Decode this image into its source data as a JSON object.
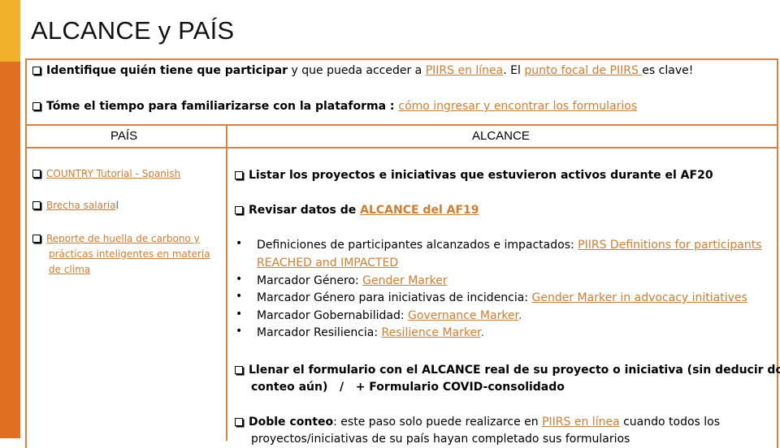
{
  "colors": {
    "accent_gold": "#F1B12A",
    "accent_orange": "#E0701F",
    "border": "#D9823F",
    "link": "#D07D33"
  },
  "title": "ALCANCE y PAÍS",
  "intro": [
    {
      "bold": "Identifique quién tiene que participar",
      "text1": " y que pueda acceder a ",
      "link1": "PIIRS en línea",
      "text2": ". El ",
      "link2": "punto focal de PIIRS ",
      "text3": "es clave!"
    },
    {
      "bold": "Tóme el tiempo para familiarizarse con la plataforma : ",
      "link1": "cómo ingresar y encontrar los formularios"
    }
  ],
  "table": {
    "headers": {
      "left": "PAÍS",
      "right": "ALCANCE"
    },
    "pais_items": [
      {
        "label": "COUNTRY Tutorial - Spanish"
      },
      {
        "label": "Brecha salaria",
        "trailing": "l"
      },
      {
        "line1": "Reporte de huella de carbono y",
        "line2": "prácticas inteligentes en materia",
        "line3": "de clima"
      }
    ],
    "alcance_items": {
      "item1": "Listar los proyectos e iniciativas que estuvieron activos durante el AF20",
      "item2_text": "Revisar datos de ",
      "item2_link": "ALCANCE del AF19",
      "bullets": [
        {
          "text": "Definiciones de participantes alcanzados e impactados: ",
          "link": "PIIRS Definitions for participants",
          "link_line2": "REACHED and IMPACTED",
          "suffix": ""
        },
        {
          "text": "Marcador Género: ",
          "link": "Gender Marker",
          "suffix": ""
        },
        {
          "text": "Marcador Género para iniciativas de incidencia: ",
          "link": "Gender Marker in advocacy initiatives",
          "suffix": ""
        },
        {
          "text": "Marcador Gobernabilidad: ",
          "link": "Governance Marker",
          "suffix": "."
        },
        {
          "text": "Marcador Resiliencia: ",
          "link": "Resilience Marker",
          "suffix": "."
        }
      ],
      "item3_line1": "Llenar el formulario con el ALCANCE real de su proyecto o iniciativa (sin deducir doble",
      "item3_line2": "conteo aún)   /   + Formulario COVID-consolidado",
      "item4_bold": "Doble conteo",
      "item4_text1": ": este paso solo puede realizarce en ",
      "item4_link": "PIIRS en línea",
      "item4_text2": " cuando todos los",
      "item4_line2": "proyectos/iniciativas de su país hayan completado sus formularios"
    },
    "bullet_char": "•"
  }
}
